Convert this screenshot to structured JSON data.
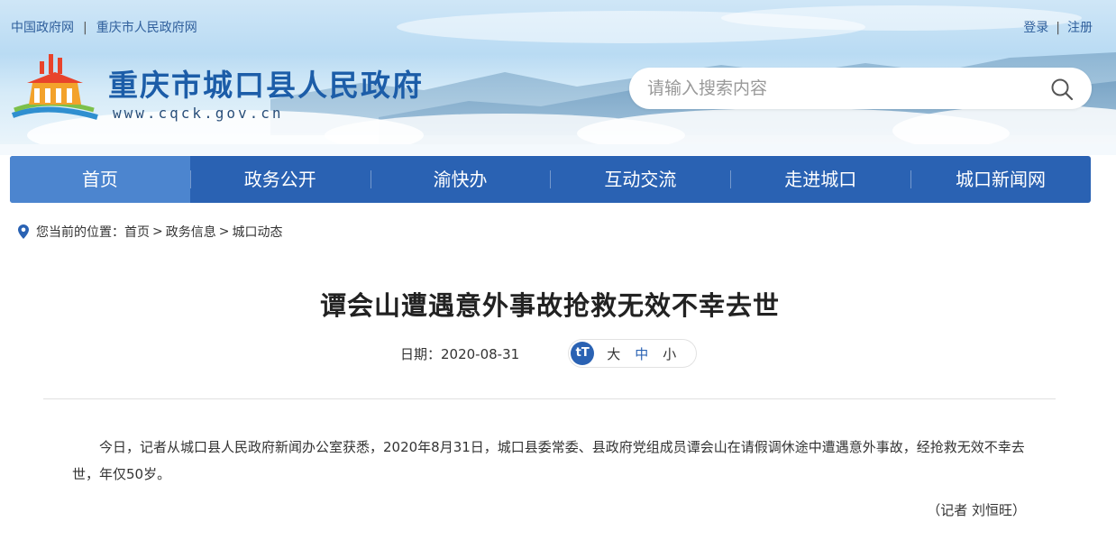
{
  "top_links": {
    "gov_cn": "中国政府网",
    "sep": "|",
    "cq_gov": "重庆市人民政府网"
  },
  "user_links": {
    "login": "登录",
    "sep": "|",
    "register": "注册"
  },
  "site": {
    "name": "重庆市城口县人民政府",
    "url": "www.cqck.gov.cn"
  },
  "search": {
    "placeholder": "请输入搜索内容"
  },
  "nav": {
    "items": [
      {
        "label": "首页"
      },
      {
        "label": "政务公开"
      },
      {
        "label": "渝快办"
      },
      {
        "label": "互动交流"
      },
      {
        "label": "走进城口"
      },
      {
        "label": "城口新闻网"
      }
    ]
  },
  "breadcrumb": {
    "prefix": "您当前的位置：",
    "items": [
      "首页",
      "政务信息",
      "城口动态"
    ],
    "sep": ">"
  },
  "article": {
    "title": "谭会山遭遇意外事故抢救无效不幸去世",
    "date": "日期：2020-08-31",
    "font_icon": "tT",
    "font_sizes": [
      "大",
      "中",
      "小"
    ],
    "body": "今日，记者从城口县人民政府新闻办公室获悉，2020年8月31日，城口县委常委、县政府党组成员谭会山在请假调休途中遭遇意外事故，经抢救无效不幸去世，年仅50岁。",
    "author": "（记者 刘恒旺）"
  },
  "colors": {
    "nav_bg": "#2a62b3",
    "nav_active": "#4c85cf",
    "brand_blue": "#1c5da8"
  }
}
